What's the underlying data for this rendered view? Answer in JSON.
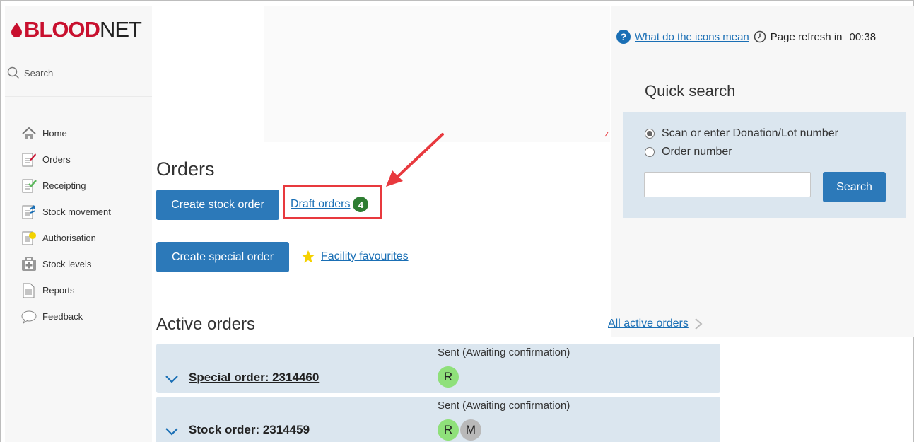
{
  "brand": {
    "logo_bold": "BLOOD",
    "logo_light": "NET",
    "accent": "#c8102e"
  },
  "sidebar": {
    "search_label": "Search",
    "items": [
      {
        "label": "Home",
        "icon": "home-icon"
      },
      {
        "label": "Orders",
        "icon": "orders-icon"
      },
      {
        "label": "Receipting",
        "icon": "receipting-icon"
      },
      {
        "label": "Stock movement",
        "icon": "stock-movement-icon"
      },
      {
        "label": "Authorisation",
        "icon": "authorisation-icon"
      },
      {
        "label": "Stock levels",
        "icon": "stock-levels-icon"
      },
      {
        "label": "Reports",
        "icon": "reports-icon"
      },
      {
        "label": "Feedback",
        "icon": "feedback-icon"
      }
    ]
  },
  "header": {
    "help_link": "What do the icons mean",
    "refresh_label": "Page refresh in",
    "refresh_time": "00:38"
  },
  "quick_search": {
    "title": "Quick search",
    "options": [
      "Scan or enter Donation/Lot number",
      "Order number"
    ],
    "selected_option": "Scan or enter Donation/Lot number",
    "input_value": "",
    "button_label": "Search"
  },
  "orders": {
    "title": "Orders",
    "create_stock_label": "Create stock order",
    "draft_label": "Draft orders",
    "draft_count": "4",
    "create_special_label": "Create special order",
    "favourites_label": "Facility favourites"
  },
  "active_orders": {
    "title": "Active orders",
    "all_link": "All active orders",
    "rows": [
      {
        "title": "Special order: 2314460",
        "status": "Sent (Awaiting confirmation)",
        "avatars": [
          "R"
        ]
      },
      {
        "title": "Stock order: 2314459",
        "status": "Sent (Awaiting confirmation)",
        "avatars": [
          "R",
          "M"
        ]
      }
    ]
  },
  "colors": {
    "primary_button": "#2c79b9",
    "link": "#1a6fb5",
    "panel": "#dbe6ef",
    "badge": "#2e7d32",
    "highlight": "#e8393e"
  }
}
